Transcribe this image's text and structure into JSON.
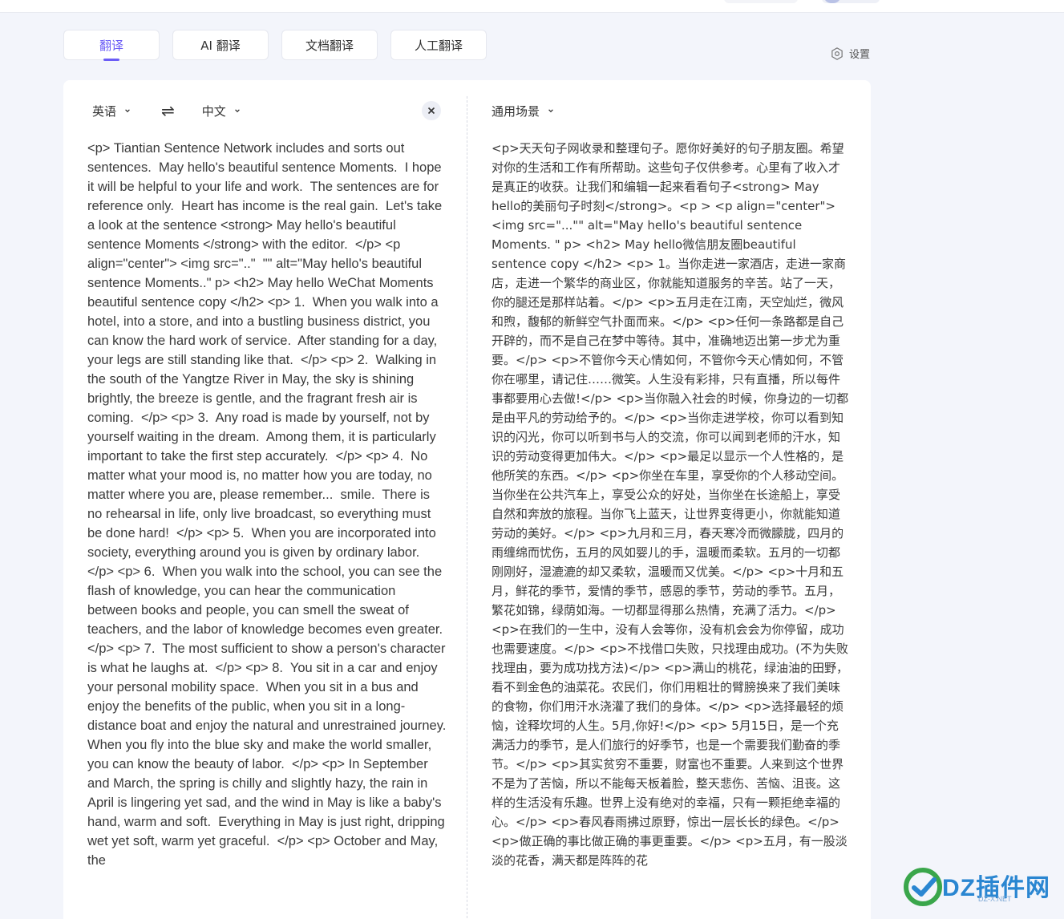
{
  "tabs": [
    {
      "label": "翻译",
      "active": true
    },
    {
      "label": "AI 翻译",
      "active": false
    },
    {
      "label": "文档翻译",
      "active": false
    },
    {
      "label": "人工翻译",
      "active": false
    }
  ],
  "settings_label": "设置",
  "source": {
    "language": "英语",
    "text": "<p> Tiantian Sentence Network includes and sorts out sentences.  May hello's beautiful sentence Moments.  I hope it will be helpful to your life and work.  The sentences are for reference only.  Heart has income is the real gain.  Let's take a look at the sentence <strong> May hello's beautiful sentence Moments </strong> with the editor.  </p> <p align=\"center\"> <img src=\"..\"  \"\" alt=\"May hello's beautiful sentence Moments..\" p> <h2> May hello WeChat Moments beautiful sentence copy </h2> <p> 1.  When you walk into a hotel, into a store, and into a bustling business district, you can know the hard work of service.  After standing for a day, your legs are still standing like that.  </p> <p> 2.  Walking in the south of the Yangtze River in May, the sky is shining brightly, the breeze is gentle, and the fragrant fresh air is coming.  </p> <p> 3.  Any road is made by yourself, not by yourself waiting in the dream.  Among them, it is particularly important to take the first step accurately.  </p> <p> 4.  No matter what your mood is, no matter how you are today, no matter where you are, please remember...  smile.  There is no rehearsal in life, only live broadcast, so everything must be done hard!  </p> <p> 5.  When you are incorporated into society, everything around you is given by ordinary labor.  </p> <p> 6.  When you walk into the school, you can see the flash of knowledge, you can hear the communication between books and people, you can smell the sweat of teachers, and the labor of knowledge becomes even greater.  </p> <p> 7.  The most sufficient to show a person's character is what he laughs at.  </p> <p> 8.  You sit in a car and enjoy your personal mobility space.  When you sit in a bus and enjoy the benefits of the public, when you sit in a long-distance boat and enjoy the natural and unrestrained journey.  When you fly into the blue sky and make the world smaller, you can know the beauty of labor.  </p> <p> In September and March, the spring is chilly and slightly hazy, the rain in April is lingering yet sad, and the wind in May is like a baby's hand, warm and soft.  Everything in May is just right, dripping wet yet soft, warm yet graceful.  </p> <p> October and May, the"
  },
  "swap_icon": "⇌",
  "target": {
    "language": "中文",
    "scene": "通用场景",
    "text": "<p>天天句子网收录和整理句子。愿你好美好的句子朋友圈。希望对你的生活和工作有所帮助。这些句子仅供参考。心里有了收入才是真正的收获。让我们和编辑一起来看看句子<strong> May hello的美丽句子时刻</strong>。<p > <p align=\"center\"> <img src=\"...\"\" alt=\"May hello's beautiful sentence Moments. \" p> <h2> May hello微信朋友圈beautiful sentence copy </h2> <p> 1。当你走进一家酒店，走进一家商店，走进一个繁华的商业区，你就能知道服务的辛苦。站了一天，你的腿还是那样站着。</p> <p>五月走在江南，天空灿烂，微风和煦，馥郁的新鲜空气扑面而来。</p> <p>任何一条路都是自己开辟的，而不是自己在梦中等待。其中，准确地迈出第一步尤为重要。</p> <p>不管你今天心情如何，不管你今天心情如何，不管你在哪里，请记住……微笑。人生没有彩排，只有直播，所以每件事都要用心去做!</p> <p>当你融入社会的时候，你身边的一切都是由平凡的劳动给予的。</p> <p>当你走进学校，你可以看到知识的闪光，你可以听到书与人的交流，你可以闻到老师的汗水，知识的劳动变得更加伟大。</p> <p>最足以显示一个人性格的，是他所笑的东西。</p> <p>你坐在车里，享受你的个人移动空间。当你坐在公共汽车上，享受公众的好处，当你坐在长途船上，享受自然和奔放的旅程。当你飞上蓝天，让世界变得更小，你就能知道劳动的美好。</p> <p>九月和三月，春天寒冷而微朦胧，四月的雨缠绵而忧伤，五月的风如婴儿的手，温暖而柔软。五月的一切都刚刚好，湿漉漉的却又柔软，温暖而又优美。</p> <p>十月和五月，鲜花的季节，爱情的季节，感恩的季节，劳动的季节。五月，繁花如锦，绿荫如海。一切都显得那么热情，充满了活力。</p> <p>在我们的一生中，没有人会等你，没有机会会为你停留，成功也需要速度。</p> <p>不找借口失败，只找理由成功。(不为失败找理由，要为成功找方法)</p> <p>满山的桃花，绿油油的田野，看不到金色的油菜花。农民们，你们用粗壮的臂膀换来了我们美味的食物，你们用汗水浇灌了我们的身体。</p> <p>选择最轻的烦恼，诠释坎坷的人生。5月,你好!</p> <p> 5月15日，是一个充满活力的季节，是人们旅行的好季节，也是一个需要我们勤奋的季节。</p> <p>其实贫穷不重要，财富也不重要。人来到这个世界不是为了苦恼，所以不能每天板着脸，整天悲伤、苦恼、沮丧。这样的生活没有乐趣。世界上没有绝对的幸福，只有一颗拒绝幸福的心。</p> <p>春风春雨拂过原野，惊出一层长长的绿色。</p> <p>做正确的事比做正确的事更重要。</p> <p>五月，有一股淡淡的花香，满天都是阵阵的花"
  },
  "watermark": {
    "text": "DZ插件网",
    "sub": "DZ-X.NET"
  }
}
